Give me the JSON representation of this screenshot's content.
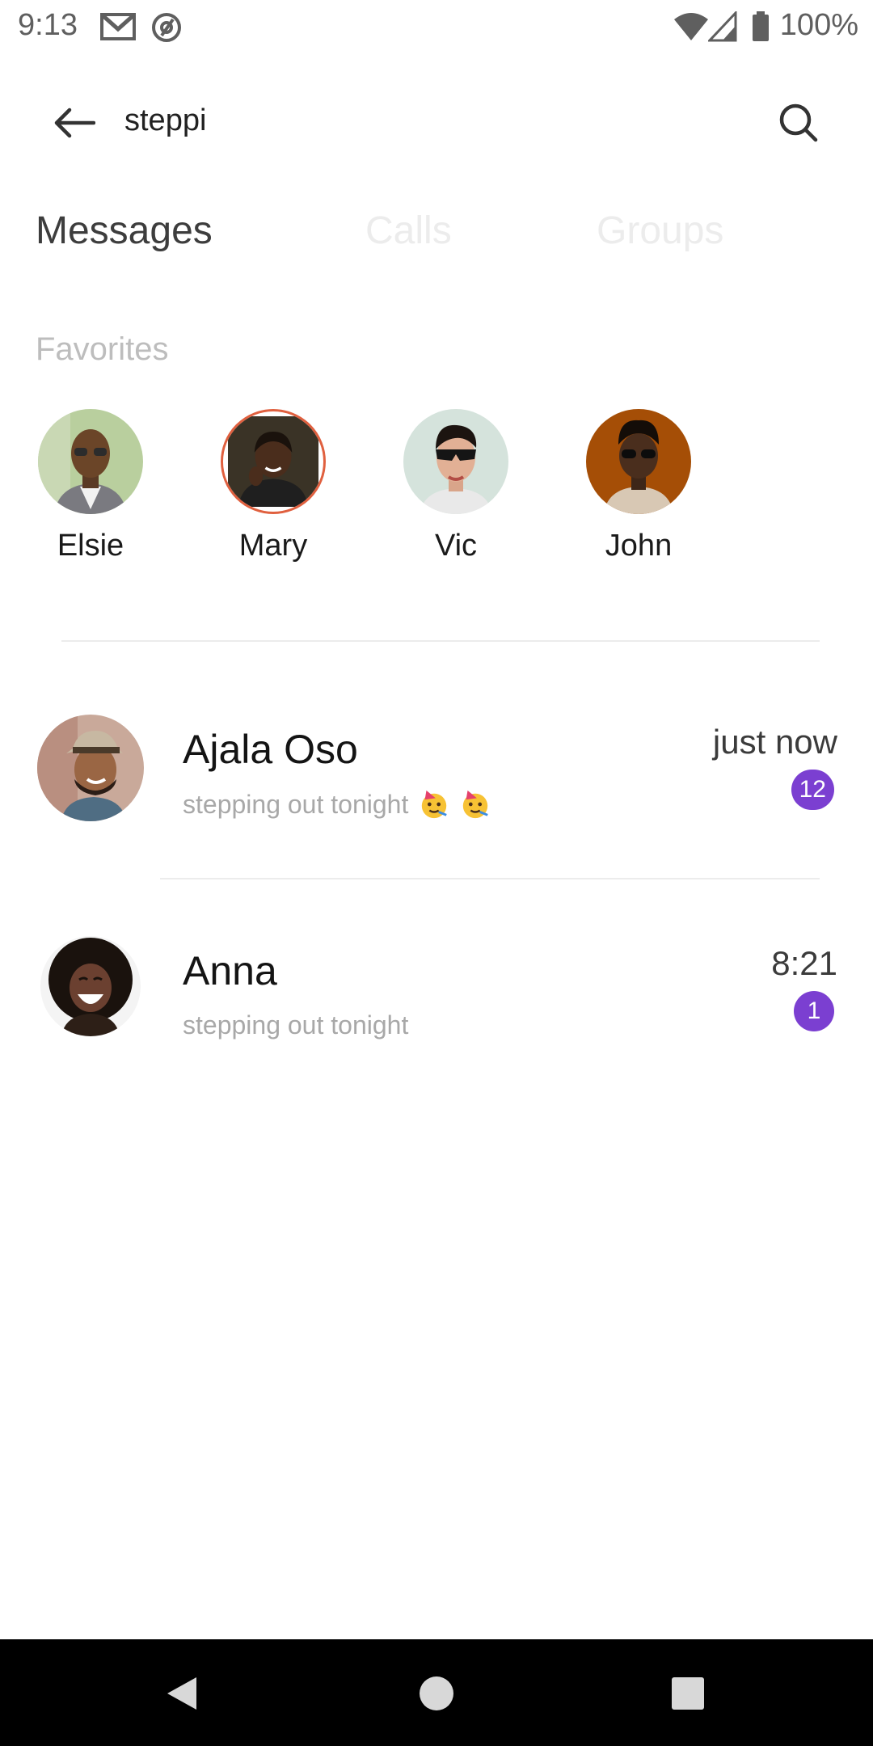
{
  "status_bar": {
    "time": "9:13",
    "battery": "100%",
    "icons": [
      "gmail-icon",
      "at-sign-icon",
      "wifi-icon",
      "cellular-icon",
      "battery-icon"
    ]
  },
  "header": {
    "search_query": "steppi",
    "back_icon": "arrow-left-icon",
    "search_icon": "search-icon"
  },
  "tabs": [
    {
      "label": "Messages",
      "active": true
    },
    {
      "label": "Calls",
      "active": false
    },
    {
      "label": "Groups",
      "active": false
    }
  ],
  "favorites": {
    "title": "Favorites",
    "items": [
      {
        "name": "Elsie"
      },
      {
        "name": "Mary"
      },
      {
        "name": "Vic"
      },
      {
        "name": "John"
      }
    ]
  },
  "chats": [
    {
      "name": "Ajala Oso",
      "preview": "stepping out tonight",
      "emoji": "partying-face-emoji",
      "time": "just now",
      "unread": "12"
    },
    {
      "name": "Anna",
      "preview": "stepping out tonight",
      "time": "8:21",
      "unread": "1"
    }
  ],
  "colors": {
    "accent": "#7b3fd1",
    "favorite_ring": "#e0603f",
    "inactive_tab": "#ececec"
  }
}
